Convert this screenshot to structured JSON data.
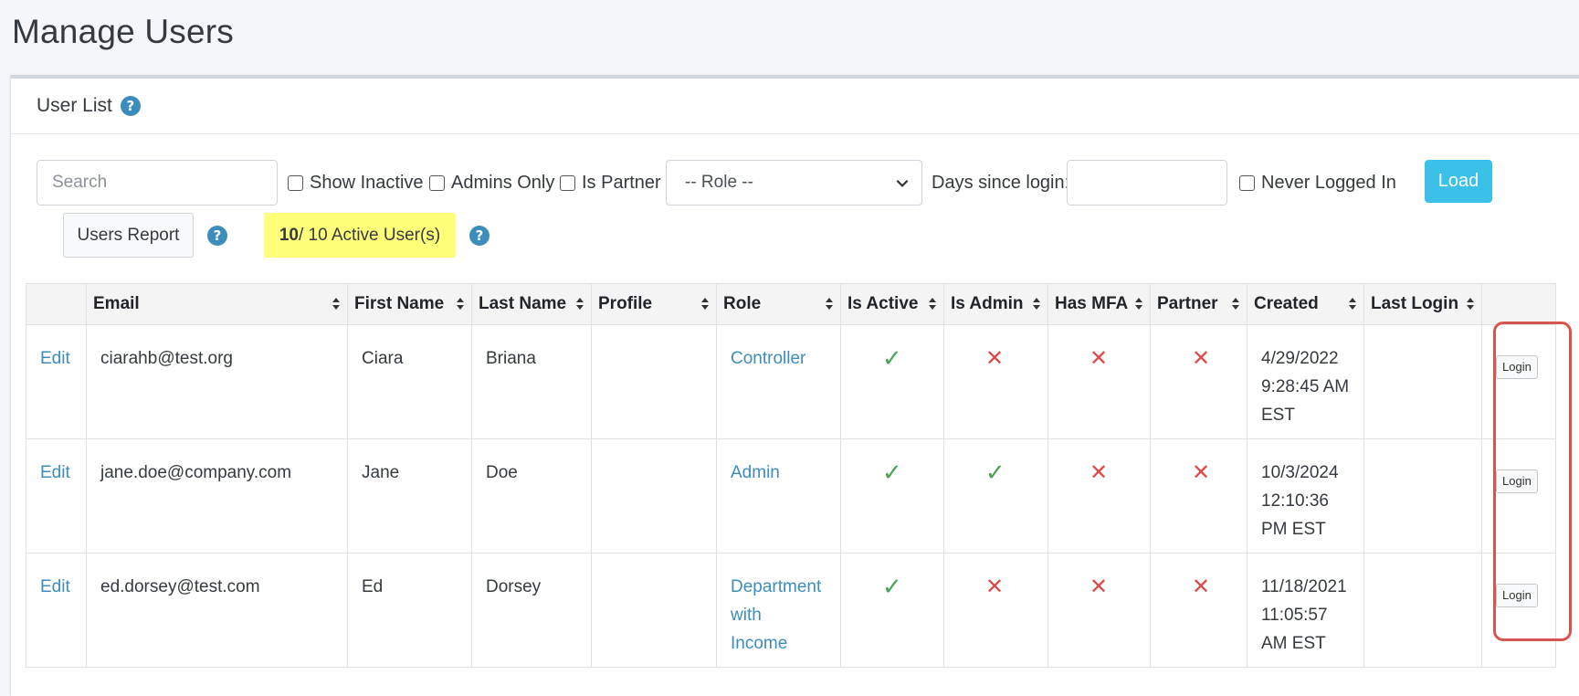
{
  "page": {
    "title": "Manage Users"
  },
  "card": {
    "header": "User List"
  },
  "toolbar": {
    "search_placeholder": "Search",
    "show_inactive": "Show Inactive",
    "admins_only": "Admins Only",
    "is_partner": "Is Partner",
    "role_selected": "-- Role --",
    "days_label": "Days since login:",
    "never_logged_in": "Never Logged In",
    "load": "Load",
    "users_report": "Users Report",
    "active_count": "10",
    "active_text": " / 10 Active User(s)"
  },
  "icons": {
    "help": "question-circle-icon",
    "sort": "sort-icon",
    "check": "check-icon",
    "cross": "cross-icon"
  },
  "colors": {
    "accent": "#3c8dbc",
    "load_button": "#3bc0e8",
    "badge": "#ffff7a",
    "check": "#4aa356",
    "cross": "#e04848",
    "highlight": "#d9534f"
  },
  "table": {
    "headers": [
      "",
      "Email",
      "First Name",
      "Last Name",
      "Profile",
      "Role",
      "Is Active",
      "Is Admin",
      "Has MFA",
      "Partner",
      "Created",
      "Last Login",
      ""
    ],
    "rows": [
      {
        "edit": "Edit",
        "email": "ciarahb@test.org",
        "first": "Ciara",
        "last": "Briana",
        "profile": "",
        "role": "Controller",
        "created_date": "4/29/2022",
        "created_time": "9:28:45 AM",
        "created_tz": "EST",
        "last_login": "",
        "login": "Login"
      },
      {
        "edit": "Edit",
        "email": "jane.doe@company.com",
        "first": "Jane",
        "last": "Doe",
        "profile": "",
        "role": "Admin",
        "created_date": "10/3/2024",
        "created_time": "12:10:36",
        "created_tz": "PM EST",
        "last_login": "",
        "login": "Login"
      },
      {
        "edit": "Edit",
        "email": "ed.dorsey@test.com",
        "first": "Ed",
        "last": "Dorsey",
        "profile": "",
        "role_l1": "Department",
        "role_l2": "with",
        "role_l3": "Income",
        "created_date": "11/18/2021",
        "created_time": "11:05:57",
        "created_tz": "AM EST",
        "last_login": "",
        "login": "Login"
      }
    ]
  }
}
